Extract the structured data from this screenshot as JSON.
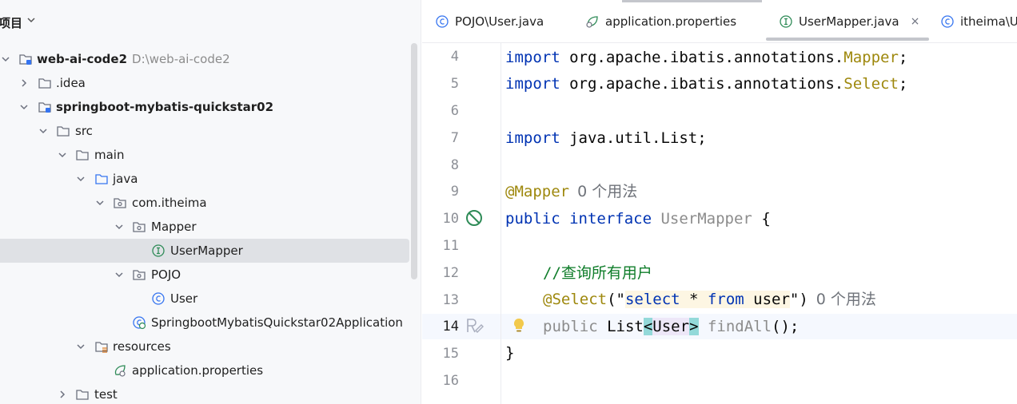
{
  "project_panel": {
    "title": "项目",
    "tree": [
      {
        "label": "web-ai-code2",
        "path": "D:\\web-ai-code2",
        "bold": true
      },
      {
        "label": ".idea"
      },
      {
        "label": "springboot-mybatis-quickstar02",
        "bold": true
      },
      {
        "label": "src"
      },
      {
        "label": "main"
      },
      {
        "label": "java"
      },
      {
        "label": "com.itheima"
      },
      {
        "label": "Mapper"
      },
      {
        "label": "UserMapper",
        "selected": true
      },
      {
        "label": "POJO"
      },
      {
        "label": "User"
      },
      {
        "label": "SpringbootMybatisQuickstar02Application"
      },
      {
        "label": "resources"
      },
      {
        "label": "application.properties"
      },
      {
        "label": "test"
      }
    ]
  },
  "tabs": [
    {
      "label": "POJO\\User.java",
      "icon": "class-icon"
    },
    {
      "label": "application.properties",
      "icon": "properties-icon"
    },
    {
      "label": "UserMapper.java",
      "icon": "interface-icon",
      "active": true,
      "close": "×"
    },
    {
      "label": "itheima\\U",
      "icon": "class-icon"
    }
  ],
  "editor": {
    "line_numbers": [
      "4",
      "5",
      "6",
      "7",
      "8",
      "9",
      "10",
      "11",
      "12",
      "13",
      "14",
      "15",
      "16"
    ],
    "current_line": "14",
    "code": {
      "l4_kw": "import",
      "l4_pkg": " org.apache.ibatis.annotations.",
      "l4_cls": "Mapper",
      "l4_end": ";",
      "l5_kw": "import",
      "l5_pkg": " org.apache.ibatis.annotations.",
      "l5_cls": "Select",
      "l5_end": ";",
      "l7_kw": "import",
      "l7_rest": " java.util.List;",
      "l9_ann": "@Mapper",
      "l9_hint": "0 个用法",
      "l10_kw1": "public",
      "l10_kw2": " interface",
      "l10_name": " UserMapper",
      "l10_brace": " {",
      "l12_comment": "//查询所有用户",
      "l13_ann": "@Select",
      "l13_open": "(\"",
      "l13_s1": "select",
      "l13_s2": " * ",
      "l13_s3": "from",
      "l13_s4": " user",
      "l13_close": "\")",
      "l13_hint": "0 个用法",
      "l14_kw": "public",
      "l14_type": " List",
      "l14_lt": "<",
      "l14_generic": "User",
      "l14_gt": ">",
      "l14_method": " findAll",
      "l14_end": "();",
      "l15_brace": "}"
    }
  }
}
